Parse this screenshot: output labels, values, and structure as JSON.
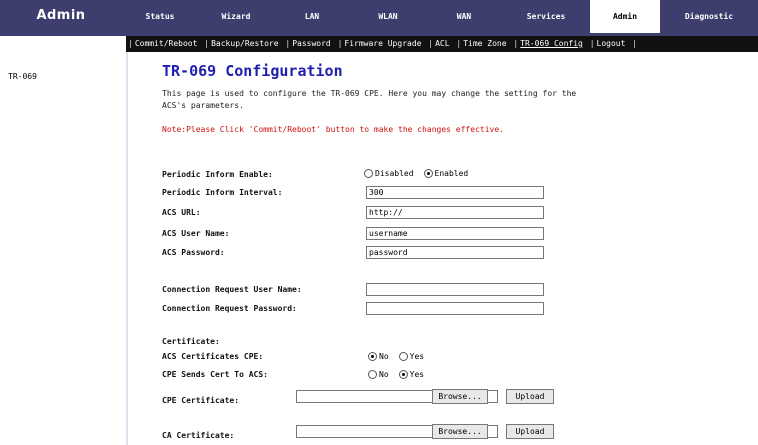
{
  "header": {
    "title": "Admin",
    "tabs": [
      "Status",
      "Wizard",
      "LAN",
      "WLAN",
      "WAN",
      "Services",
      "Admin",
      "Diagnostic"
    ],
    "active_tab": "Admin"
  },
  "submenu": {
    "items": [
      "Commit/Reboot",
      "Backup/Restore",
      "Password",
      "Firmware Upgrade",
      "ACL",
      "Time Zone",
      "TR-069 Config",
      "Logout"
    ],
    "active": "TR-069 Config"
  },
  "sidebar": {
    "items": [
      {
        "label": "TR-069"
      }
    ]
  },
  "main": {
    "title": "TR-069 Configuration",
    "description": "This page is used to configure the TR-069 CPE. Here you may change the setting for the ACS's parameters.",
    "note": "Note:Please Click 'Commit/Reboot' button to make the changes effective.",
    "fields": {
      "periodic_inform_enable": {
        "label": "Periodic Inform Enable:",
        "options": [
          "Disabled",
          "Enabled"
        ],
        "selected": "Enabled"
      },
      "periodic_inform_interval": {
        "label": "Periodic Inform Interval:",
        "value": "300"
      },
      "acs_url": {
        "label": "ACS URL:",
        "value": "http://"
      },
      "acs_user_name": {
        "label": "ACS User Name:",
        "value": "username"
      },
      "acs_password": {
        "label": "ACS Password:",
        "value": "password"
      },
      "conn_req_user_name": {
        "label": "Connection Request User Name:",
        "value": ""
      },
      "conn_req_password": {
        "label": "Connection Request Password:",
        "value": ""
      }
    },
    "certificate": {
      "heading": "Certificate:",
      "acs_cert_cpe": {
        "label": "ACS Certificates CPE:",
        "options": [
          "No",
          "Yes"
        ],
        "selected": "No"
      },
      "cpe_sends_cert": {
        "label": "CPE Sends Cert To ACS:",
        "options": [
          "No",
          "Yes"
        ],
        "selected": "Yes"
      },
      "cpe_cert_file": {
        "label": "CPE Certificate:",
        "browse": "Browse...",
        "upload": "Upload"
      },
      "ca_cert_file": {
        "label": "CA Certificate:",
        "browse": "Browse...",
        "upload": "Upload"
      }
    }
  },
  "colors": {
    "topbar": "#3e3e6e",
    "title": "#1f1fb0",
    "note": "#d01010"
  }
}
